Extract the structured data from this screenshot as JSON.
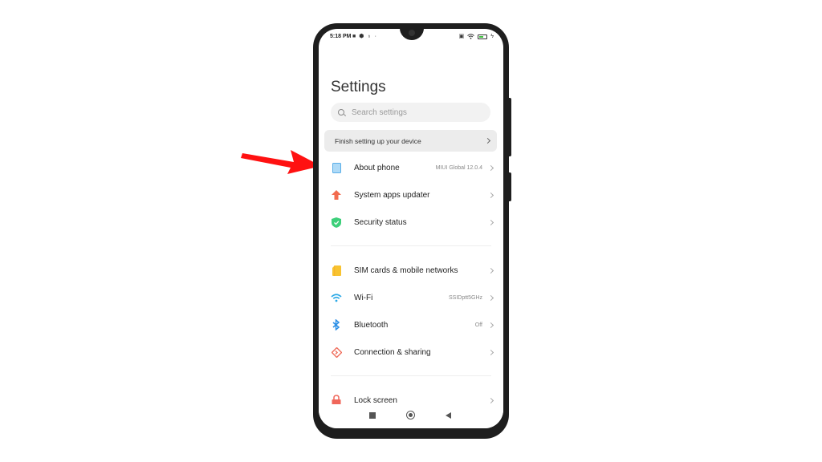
{
  "status_bar": {
    "time": "5:18 PM",
    "left_icons": [
      "video-camera-icon",
      "shield-icon",
      "location-icon",
      "dot-icon"
    ],
    "right_icons": [
      "sim-icon",
      "wifi-icon",
      "battery-icon",
      "charging-icon"
    ],
    "battery_level": 0.6
  },
  "page": {
    "title": "Settings",
    "search_placeholder": "Search settings",
    "finish_setup_label": "Finish setting up your device"
  },
  "sections": [
    {
      "items": [
        {
          "label": "About phone",
          "value": "MIUI Global 12.0.4",
          "icon": "phone-icon",
          "icon_color": "#5aaee8"
        },
        {
          "label": "System apps updater",
          "value": "",
          "icon": "arrow-up-icon",
          "icon_color": "#f26b4f"
        },
        {
          "label": "Security status",
          "value": "",
          "icon": "shield-check-icon",
          "icon_color": "#3dcf7a"
        }
      ]
    },
    {
      "items": [
        {
          "label": "SIM cards & mobile networks",
          "value": "",
          "icon": "sim-card-icon",
          "icon_color": "#f8c331"
        },
        {
          "label": "Wi-Fi",
          "value": "SSIDptt5GHz",
          "icon": "wifi-icon",
          "icon_color": "#2aa8e6"
        },
        {
          "label": "Bluetooth",
          "value": "Off",
          "icon": "bluetooth-icon",
          "icon_color": "#2a8ee6"
        },
        {
          "label": "Connection & sharing",
          "value": "",
          "icon": "connection-sharing-icon",
          "icon_color": "#ef6c5a"
        }
      ]
    },
    {
      "items": [
        {
          "label": "Lock screen",
          "value": "",
          "icon": "lock-icon",
          "icon_color": "#f0665a"
        }
      ]
    }
  ],
  "nav_bar": [
    "recents-button",
    "home-button",
    "back-button"
  ],
  "annotation": {
    "arrow_color": "#ff0000",
    "points_to": "About phone"
  }
}
